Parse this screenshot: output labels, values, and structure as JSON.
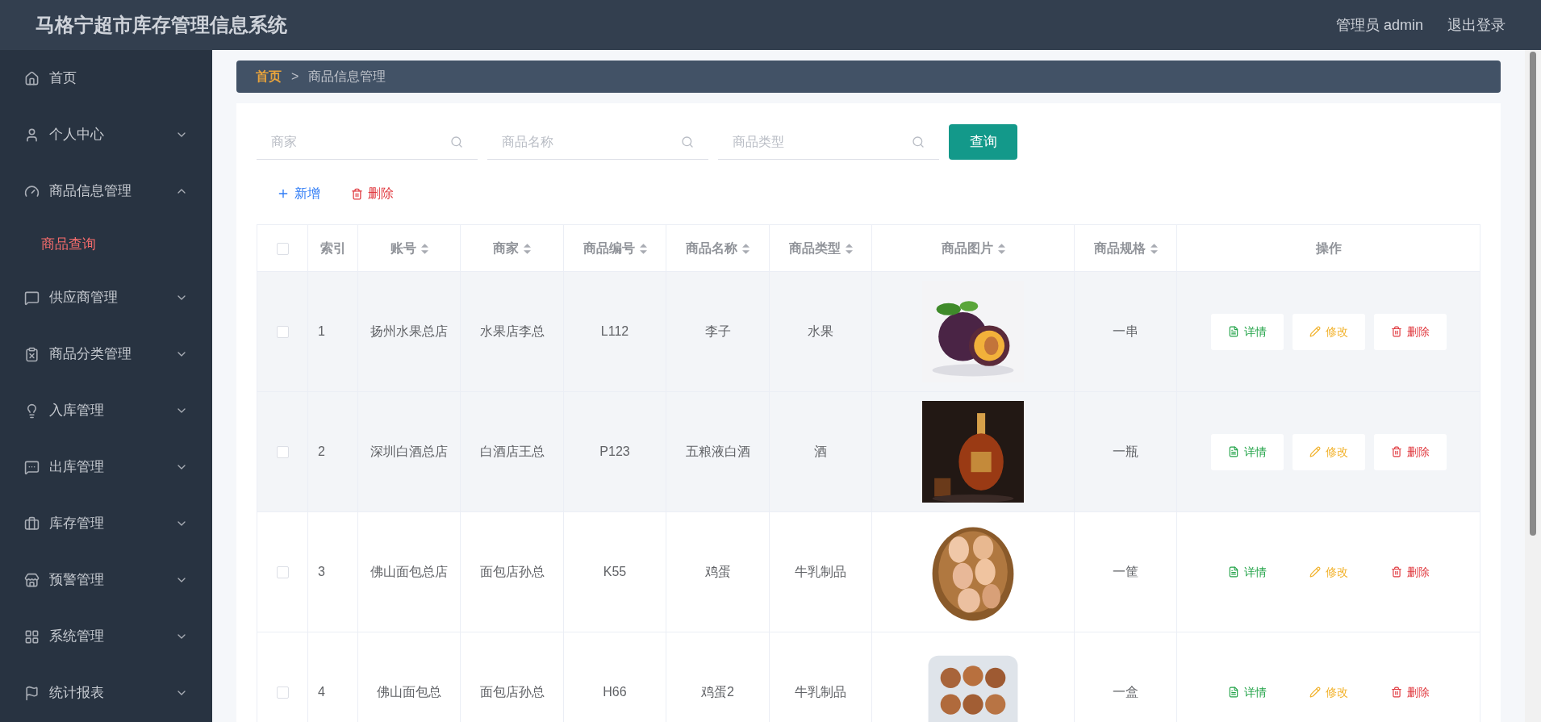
{
  "header": {
    "title": "马格宁超市库存管理信息系统",
    "user": "管理员 admin",
    "logout": "退出登录"
  },
  "sidebar": {
    "items": [
      {
        "kind": "home",
        "label": "首页"
      },
      {
        "kind": "user",
        "label": "个人中心",
        "expanded": false
      },
      {
        "kind": "gauge",
        "label": "商品信息管理",
        "expanded": true,
        "children": [
          {
            "label": "商品查询",
            "selected": true
          }
        ]
      },
      {
        "kind": "chat",
        "label": "供应商管理",
        "expanded": false
      },
      {
        "kind": "clipboard",
        "label": "商品分类管理",
        "expanded": false
      },
      {
        "kind": "bulb",
        "label": "入库管理",
        "expanded": false
      },
      {
        "kind": "message",
        "label": "出库管理",
        "expanded": false
      },
      {
        "kind": "briefcase",
        "label": "库存管理",
        "expanded": false
      },
      {
        "kind": "shop",
        "label": "预警管理",
        "expanded": false
      },
      {
        "kind": "grid",
        "label": "系统管理",
        "expanded": false
      },
      {
        "kind": "flag",
        "label": "统计报表",
        "expanded": false
      }
    ]
  },
  "breadcrumb": {
    "items": [
      "首页",
      "商品信息管理"
    ],
    "separator": ">"
  },
  "search": {
    "fields": [
      {
        "placeholder": "商家"
      },
      {
        "placeholder": "商品名称"
      },
      {
        "placeholder": "商品类型"
      }
    ],
    "button": "查询"
  },
  "actions": {
    "add": "新增",
    "delete": "删除"
  },
  "table": {
    "select_all": {
      "checked": false
    },
    "columns": [
      {
        "label": "索引",
        "sortable": false
      },
      {
        "label": "账号",
        "sortable": true
      },
      {
        "label": "商家",
        "sortable": true
      },
      {
        "label": "商品编号",
        "sortable": true
      },
      {
        "label": "商品名称",
        "sortable": true
      },
      {
        "label": "商品类型",
        "sortable": true
      },
      {
        "label": "商品图片",
        "sortable": true
      },
      {
        "label": "商品规格",
        "sortable": true
      },
      {
        "label": "操作",
        "sortable": false
      }
    ],
    "rows": [
      {
        "index": "1",
        "account": "扬州水果总店",
        "merchant": "水果店李总",
        "code": "L112",
        "name": "李子",
        "type": "水果",
        "image": {
          "kind": "picture"
        },
        "spec": "一串",
        "checked": false,
        "highlighted": true,
        "actions": [
          "详情",
          "修改",
          "删除"
        ]
      },
      {
        "index": "2",
        "account": "深圳白酒总店",
        "merchant": "白酒店王总",
        "code": "P123",
        "name": "五粮液白酒",
        "type": "酒",
        "image": {
          "kind": "picture"
        },
        "spec": "一瓶",
        "checked": false,
        "highlighted": true,
        "actions": [
          "详情",
          "修改",
          "删除"
        ]
      },
      {
        "index": "3",
        "account": "佛山面包总店",
        "merchant": "面包店孙总",
        "code": "K55",
        "name": "鸡蛋",
        "type": "牛乳制品",
        "image": {
          "kind": "picture"
        },
        "spec": "一筐",
        "checked": false,
        "highlighted": false,
        "actions": [
          "详情",
          "修改",
          "删除"
        ]
      },
      {
        "index": "4",
        "account": "佛山面包总",
        "merchant": "面包店孙总",
        "code": "H66",
        "name": "鸡蛋2",
        "type": "牛乳制品",
        "image": {
          "kind": "picture"
        },
        "spec": "一盒",
        "checked": false,
        "highlighted": false,
        "actions": [
          "详情",
          "修改",
          "删除"
        ]
      }
    ]
  }
}
